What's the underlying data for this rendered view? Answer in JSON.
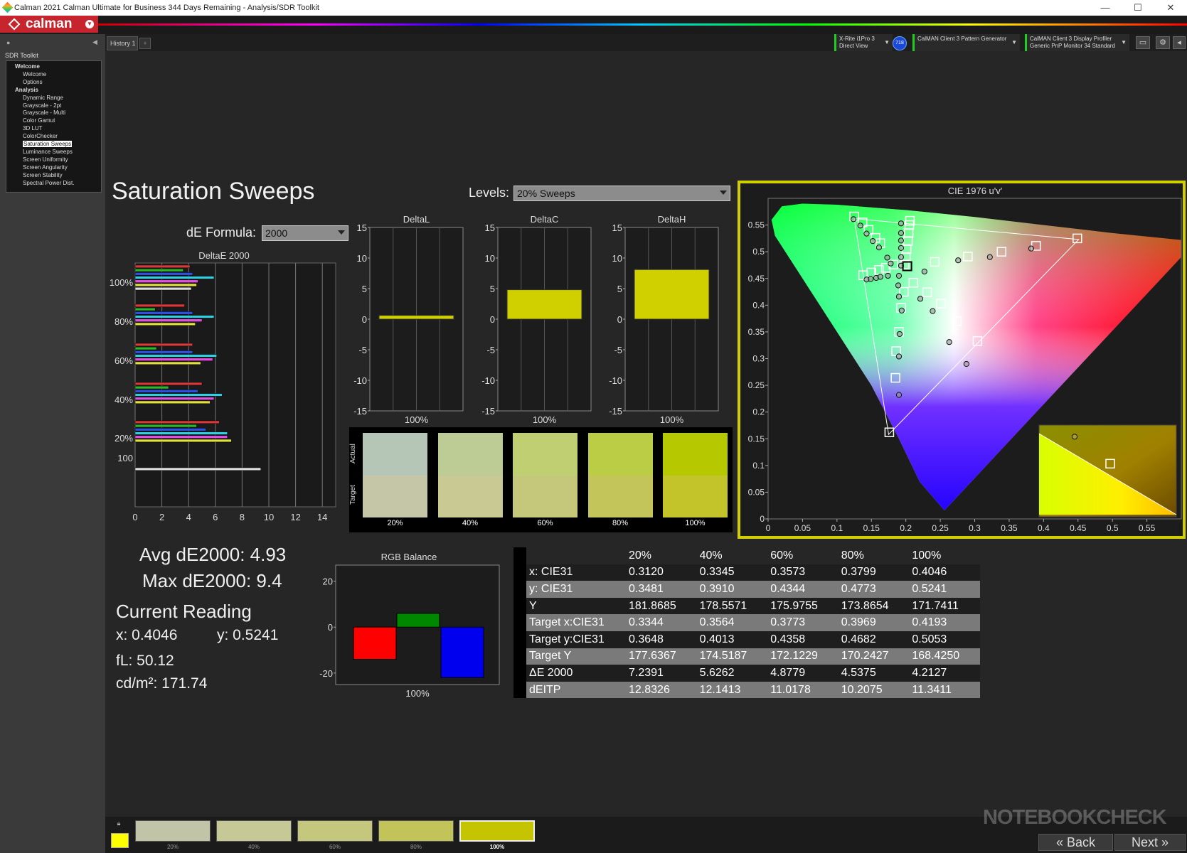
{
  "window": {
    "title": "Calman 2021 Calman Ultimate for Business 344 Days Remaining  - Analysis/SDR Toolkit",
    "controls": [
      "—",
      "☐",
      "✕"
    ]
  },
  "app": {
    "brand": "calman"
  },
  "history_tab": "History 1",
  "devices": {
    "meter": {
      "line1": "X-Rite i1Pro 3",
      "line2": "Direct View"
    },
    "badge": "718",
    "generator": {
      "line1": "CalMAN Client 3 Pattern Generator",
      "line2": ""
    },
    "display": {
      "line1": "CalMAN Client 3 Display Profiler",
      "line2": "Generic PnP Monitor 34 Standard"
    }
  },
  "sidebar": {
    "title": "SDR Toolkit",
    "tree": [
      {
        "label": "Welcome",
        "level": 0,
        "header": true
      },
      {
        "label": "Welcome",
        "level": 1
      },
      {
        "label": "Options",
        "level": 1
      },
      {
        "label": "Analysis",
        "level": 0,
        "header": true
      },
      {
        "label": "Dynamic Range",
        "level": 1
      },
      {
        "label": "Grayscale - 2pt",
        "level": 1
      },
      {
        "label": "Grayscale - Multi",
        "level": 1
      },
      {
        "label": "Color Gamut",
        "level": 1
      },
      {
        "label": "3D LUT",
        "level": 1
      },
      {
        "label": "ColorChecker",
        "level": 1
      },
      {
        "label": "Saturation Sweeps",
        "level": 1,
        "selected": true
      },
      {
        "label": "Luminance Sweeps",
        "level": 1
      },
      {
        "label": "Screen Uniformity",
        "level": 1
      },
      {
        "label": "Screen Angularity",
        "level": 1
      },
      {
        "label": "Screen Stability",
        "level": 1
      },
      {
        "label": "Spectral Power Dist.",
        "level": 1
      }
    ]
  },
  "page": {
    "title": "Saturation Sweeps",
    "levels_label": "Levels:",
    "levels_value": "20% Sweeps",
    "de_label": "dE Formula:",
    "de_value": "2000"
  },
  "stats": {
    "avg": "Avg dE2000: 4.93",
    "max": "Max dE2000: 9.4",
    "current_title": "Current Reading",
    "x": "x: 0.4046",
    "y": "y: 0.5241",
    "fl": "fL: 50.12",
    "cdm2": "cd/m²: 171.74"
  },
  "deltae_chart": {
    "title": "DeltaE 2000",
    "x_ticks": [
      "0",
      "2",
      "4",
      "6",
      "8",
      "10",
      "12",
      "14"
    ],
    "xlim": [
      0,
      15
    ],
    "groups": [
      {
        "label": "100%",
        "values": [
          4.1,
          3.6,
          4.3,
          5.9,
          4.7,
          4.6,
          4.2
        ]
      },
      {
        "label": "80%",
        "values": [
          3.7,
          1.5,
          4.3,
          5.9,
          5.0,
          4.5
        ]
      },
      {
        "label": "60%",
        "values": [
          4.3,
          1.6,
          4.3,
          6.1,
          5.8,
          4.9
        ]
      },
      {
        "label": "40%",
        "values": [
          5.0,
          2.5,
          4.7,
          6.5,
          5.9,
          5.6
        ]
      },
      {
        "label": "20%",
        "values": [
          6.3,
          4.6,
          5.3,
          6.9,
          6.9,
          7.2
        ]
      },
      {
        "label": "100",
        "values": [
          9.4
        ]
      }
    ],
    "bar_colors": [
      "#d83a3a",
      "#2ab82a",
      "#3050e0",
      "#30d0e0",
      "#e050e0",
      "#e0e040",
      "#dddddd"
    ]
  },
  "delta_charts": {
    "y_ticks": [
      "15",
      "10",
      "5",
      "0",
      "-5",
      "-10",
      "-15"
    ],
    "ylim": [
      -15,
      15
    ],
    "category": "100%",
    "items": [
      {
        "title": "DeltaL",
        "value": 0.5
      },
      {
        "title": "DeltaC",
        "value": 4.7
      },
      {
        "title": "DeltaH",
        "value": 8.0
      }
    ],
    "bar_color": "#d0d000"
  },
  "swatches": {
    "actual_label": "Actual",
    "target_label": "Target",
    "items": [
      {
        "label": "20%",
        "actual": "#b6c6b6",
        "target": "#c5c6a8"
      },
      {
        "label": "40%",
        "actual": "#bccc94",
        "target": "#c8c993"
      },
      {
        "label": "60%",
        "actual": "#bfcf72",
        "target": "#c5c77b"
      },
      {
        "label": "80%",
        "actual": "#bbcc45",
        "target": "#c3c459"
      },
      {
        "label": "100%",
        "actual": "#b6c800",
        "target": "#c3c32a"
      }
    ]
  },
  "rgb_balance": {
    "title": "RGB Balance",
    "y_ticks": [
      "20",
      "0",
      "-20"
    ],
    "ylim": [
      -25,
      27
    ],
    "category": "100%",
    "values": {
      "red": -14,
      "green": 6,
      "blue": -22
    }
  },
  "table": {
    "columns": [
      "20%",
      "40%",
      "60%",
      "80%",
      "100%"
    ],
    "rows": [
      {
        "label": "x: CIE31",
        "values": [
          "0.3120",
          "0.3345",
          "0.3573",
          "0.3799",
          "0.4046"
        ]
      },
      {
        "label": "y: CIE31",
        "values": [
          "0.3481",
          "0.3910",
          "0.4344",
          "0.4773",
          "0.5241"
        ]
      },
      {
        "label": "Y",
        "values": [
          "181.8685",
          "178.5571",
          "175.9755",
          "173.8654",
          "171.7411"
        ]
      },
      {
        "label": "Target x:CIE31",
        "values": [
          "0.3344",
          "0.3564",
          "0.3773",
          "0.3969",
          "0.4193"
        ]
      },
      {
        "label": "Target y:CIE31",
        "values": [
          "0.3648",
          "0.4013",
          "0.4358",
          "0.4682",
          "0.5053"
        ]
      },
      {
        "label": "Target Y",
        "values": [
          "177.6367",
          "174.5187",
          "172.1229",
          "170.2427",
          "168.4250"
        ]
      },
      {
        "label": "ΔE 2000",
        "values": [
          "7.2391",
          "5.6262",
          "4.8779",
          "4.5375",
          "4.2127"
        ]
      },
      {
        "label": "dEITP",
        "values": [
          "12.8326",
          "12.1413",
          "11.0178",
          "10.2075",
          "11.3411"
        ]
      }
    ]
  },
  "cie": {
    "title": "CIE 1976 u'v'",
    "x_ticks": [
      "0",
      "0.05",
      "0.1",
      "0.15",
      "0.2",
      "0.25",
      "0.3",
      "0.35",
      "0.4",
      "0.45",
      "0.5",
      "0.55"
    ],
    "y_ticks": [
      "0",
      "0.05",
      "0.1",
      "0.15",
      "0.2",
      "0.25",
      "0.3",
      "0.35",
      "0.4",
      "0.45",
      "0.5",
      "0.55"
    ],
    "xlim": [
      0,
      0.6
    ],
    "ylim": [
      0,
      0.6
    ],
    "targets": [
      [
        0.125,
        0.566
      ],
      [
        0.137,
        0.555
      ],
      [
        0.146,
        0.541
      ],
      [
        0.156,
        0.526
      ],
      [
        0.163,
        0.516
      ],
      [
        0.138,
        0.456
      ],
      [
        0.15,
        0.461
      ],
      [
        0.161,
        0.466
      ],
      [
        0.171,
        0.47
      ],
      [
        0.182,
        0.476
      ],
      [
        0.198,
        0.476
      ],
      [
        0.2,
        0.49
      ],
      [
        0.201,
        0.505
      ],
      [
        0.203,
        0.52
      ],
      [
        0.204,
        0.535
      ],
      [
        0.205,
        0.55
      ],
      [
        0.206,
        0.558
      ],
      [
        0.197,
        0.425
      ],
      [
        0.193,
        0.395
      ],
      [
        0.19,
        0.35
      ],
      [
        0.186,
        0.314
      ],
      [
        0.185,
        0.264
      ],
      [
        0.176,
        0.162
      ],
      [
        0.242,
        0.481
      ],
      [
        0.29,
        0.491
      ],
      [
        0.339,
        0.5
      ],
      [
        0.389,
        0.511
      ],
      [
        0.449,
        0.525
      ],
      [
        0.211,
        0.442
      ],
      [
        0.231,
        0.424
      ],
      [
        0.251,
        0.403
      ],
      [
        0.274,
        0.37
      ],
      [
        0.304,
        0.333
      ]
    ],
    "measured": [
      [
        0.124,
        0.561
      ],
      [
        0.134,
        0.549
      ],
      [
        0.143,
        0.534
      ],
      [
        0.152,
        0.52
      ],
      [
        0.161,
        0.508
      ],
      [
        0.143,
        0.448
      ],
      [
        0.149,
        0.449
      ],
      [
        0.157,
        0.451
      ],
      [
        0.163,
        0.453
      ],
      [
        0.174,
        0.455
      ],
      [
        0.19,
        0.455
      ],
      [
        0.193,
        0.474
      ],
      [
        0.193,
        0.49
      ],
      [
        0.193,
        0.507
      ],
      [
        0.193,
        0.521
      ],
      [
        0.193,
        0.535
      ],
      [
        0.193,
        0.553
      ],
      [
        0.173,
        0.489
      ],
      [
        0.178,
        0.478
      ],
      [
        0.189,
        0.437
      ],
      [
        0.19,
        0.416
      ],
      [
        0.194,
        0.39
      ],
      [
        0.191,
        0.346
      ],
      [
        0.19,
        0.304
      ],
      [
        0.19,
        0.232
      ],
      [
        0.227,
        0.463
      ],
      [
        0.276,
        0.484
      ],
      [
        0.322,
        0.49
      ],
      [
        0.382,
        0.506
      ],
      [
        0.221,
        0.412
      ],
      [
        0.239,
        0.389
      ],
      [
        0.263,
        0.331
      ],
      [
        0.288,
        0.29
      ]
    ],
    "current": [
      0.202,
      0.473
    ],
    "inset_measured": [
      0.437,
      0.166
    ],
    "inset_target": [
      0.494,
      0.11
    ]
  },
  "bottom": {
    "lock_icon": "lock",
    "current_color": "#ffff00",
    "swatches": [
      {
        "label": "20%",
        "color": "#c2c4a8"
      },
      {
        "label": "40%",
        "color": "#c6c895"
      },
      {
        "label": "60%",
        "color": "#c5c87c"
      },
      {
        "label": "80%",
        "color": "#c2c45a"
      },
      {
        "label": "100%",
        "color": "#c4c400",
        "active": true
      }
    ],
    "back": "Back",
    "next": "Next",
    "watermark": "NOTEBOOKCHECK"
  }
}
